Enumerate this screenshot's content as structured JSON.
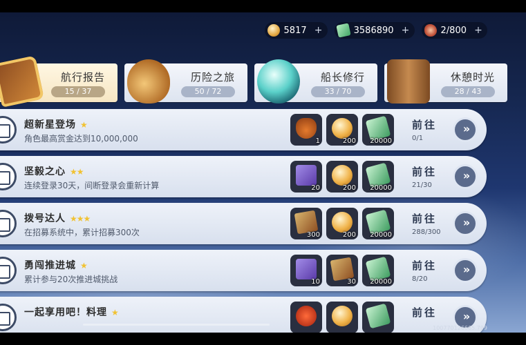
{
  "currencies": [
    {
      "icon": "coin-icon",
      "value": "5817"
    },
    {
      "icon": "cash-icon",
      "value": "3586890"
    },
    {
      "icon": "meat-icon",
      "value": "2/800"
    }
  ],
  "plus_symbol": "+",
  "tabs": [
    {
      "label": "航行报告",
      "progress": "15 / 37",
      "icon": "book-icon",
      "active": true
    },
    {
      "label": "历险之旅",
      "progress": "50 / 72",
      "icon": "hat-icon",
      "active": false
    },
    {
      "label": "船长修行",
      "progress": "33 / 70",
      "icon": "orb-icon",
      "active": false
    },
    {
      "label": "休憩时光",
      "progress": "28 / 43",
      "icon": "mug-icon",
      "active": false
    }
  ],
  "tasks": [
    {
      "title": "超新星登场",
      "stars": "★",
      "desc": "角色最高赏金达到10,000,000",
      "rewards": [
        {
          "icon": "bag-icon",
          "count": "1"
        },
        {
          "icon": "coin-icon",
          "count": "200"
        },
        {
          "icon": "cash-icon",
          "count": "20000"
        }
      ],
      "goto": "前往",
      "progress": "0/1"
    },
    {
      "title": "坚毅之心",
      "stars": "★★",
      "desc": "连续登录30天，间断登录会重新计算",
      "rewards": [
        {
          "icon": "purple-box-icon",
          "count": "20"
        },
        {
          "icon": "coin-icon",
          "count": "200"
        },
        {
          "icon": "cash-icon",
          "count": "20000"
        }
      ],
      "goto": "前往",
      "progress": "21/30"
    },
    {
      "title": "拨号达人",
      "stars": "★★★",
      "desc": "在招募系统中，累计招募300次",
      "rewards": [
        {
          "icon": "scroll-icon",
          "count": "300"
        },
        {
          "icon": "coin-icon",
          "count": "200"
        },
        {
          "icon": "cash-icon",
          "count": "20000"
        }
      ],
      "goto": "前往",
      "progress": "288/300"
    },
    {
      "title": "勇闯推进城",
      "stars": "★",
      "desc": "累计参与20次推进城挑战",
      "rewards": [
        {
          "icon": "purple-box-icon",
          "count": "10"
        },
        {
          "icon": "scroll-icon",
          "count": "30"
        },
        {
          "icon": "cash-icon",
          "count": "20000"
        }
      ],
      "goto": "前往",
      "progress": "8/20"
    },
    {
      "title": "一起享用吧！料理",
      "stars": "★",
      "desc": "",
      "rewards": [
        {
          "icon": "food-icon",
          "count": ""
        },
        {
          "icon": "coin-icon",
          "count": ""
        },
        {
          "icon": "cash-icon",
          "count": ""
        }
      ],
      "goto": "前往",
      "progress": ""
    }
  ],
  "arrow_symbol": "»",
  "uid": "100770126665.799"
}
